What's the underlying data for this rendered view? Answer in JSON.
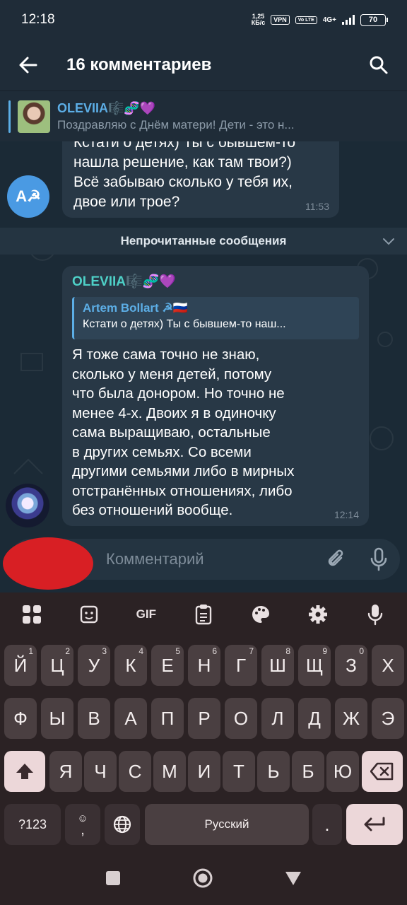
{
  "status_bar": {
    "time": "12:18",
    "speed_value": "1,25",
    "speed_unit": "КБ/с",
    "vpn": "VPN",
    "volte": "Vo LTE",
    "network": "4G+",
    "battery": "70"
  },
  "header": {
    "title": "16 комментариев"
  },
  "pinned": {
    "name": "OLEVIIA🎼🧬💜",
    "message": "Поздравляю с Днём матери!   Дети - это н..."
  },
  "previous_message": {
    "avatar_text": "A☭",
    "text": "Кстати о детях) Ты с бывшем-то\nнашла решение, как там твои?)\nВсё забываю сколько у тебя их,\nдвое или трое?",
    "time": "11:53"
  },
  "unread_divider": "Непрочитанные сообщения",
  "message": {
    "author": "OLEVIIA🎼🧬💜",
    "reply_name": "Artem Bollart ☭🇷🇺",
    "reply_text": "Кстати о детях) Ты с бывшем-то наш...",
    "text": "Я тоже сама точно не знаю,\nсколько у меня детей, потому\nчто была донором. Но точно не\nменее 4-х. Двоих я в одиночку\nсама выращиваю, остальные\nв других семьях. Со всеми\nдругими семьями либо в мирных\nотстранённых отношениях, либо\nбез отношений вообще.",
    "time": "12:14"
  },
  "composer": {
    "placeholder": "Комментарий"
  },
  "keyboard": {
    "toolbar_gif": "GIF",
    "row1": [
      "Й",
      "Ц",
      "У",
      "К",
      "Е",
      "Н",
      "Г",
      "Ш",
      "Щ",
      "З",
      "Х"
    ],
    "row1_hints": [
      "1",
      "2",
      "3",
      "4",
      "5",
      "6",
      "7",
      "8",
      "9",
      "0",
      ""
    ],
    "row2": [
      "Ф",
      "Ы",
      "В",
      "А",
      "П",
      "Р",
      "О",
      "Л",
      "Д",
      "Ж",
      "Э"
    ],
    "row3": [
      "Я",
      "Ч",
      "С",
      "М",
      "И",
      "Т",
      "Ь",
      "Б",
      "Ю"
    ],
    "symbols_label": "?123",
    "emoji_comma_label": ",",
    "space_label": "Русский",
    "period_label": "."
  }
}
